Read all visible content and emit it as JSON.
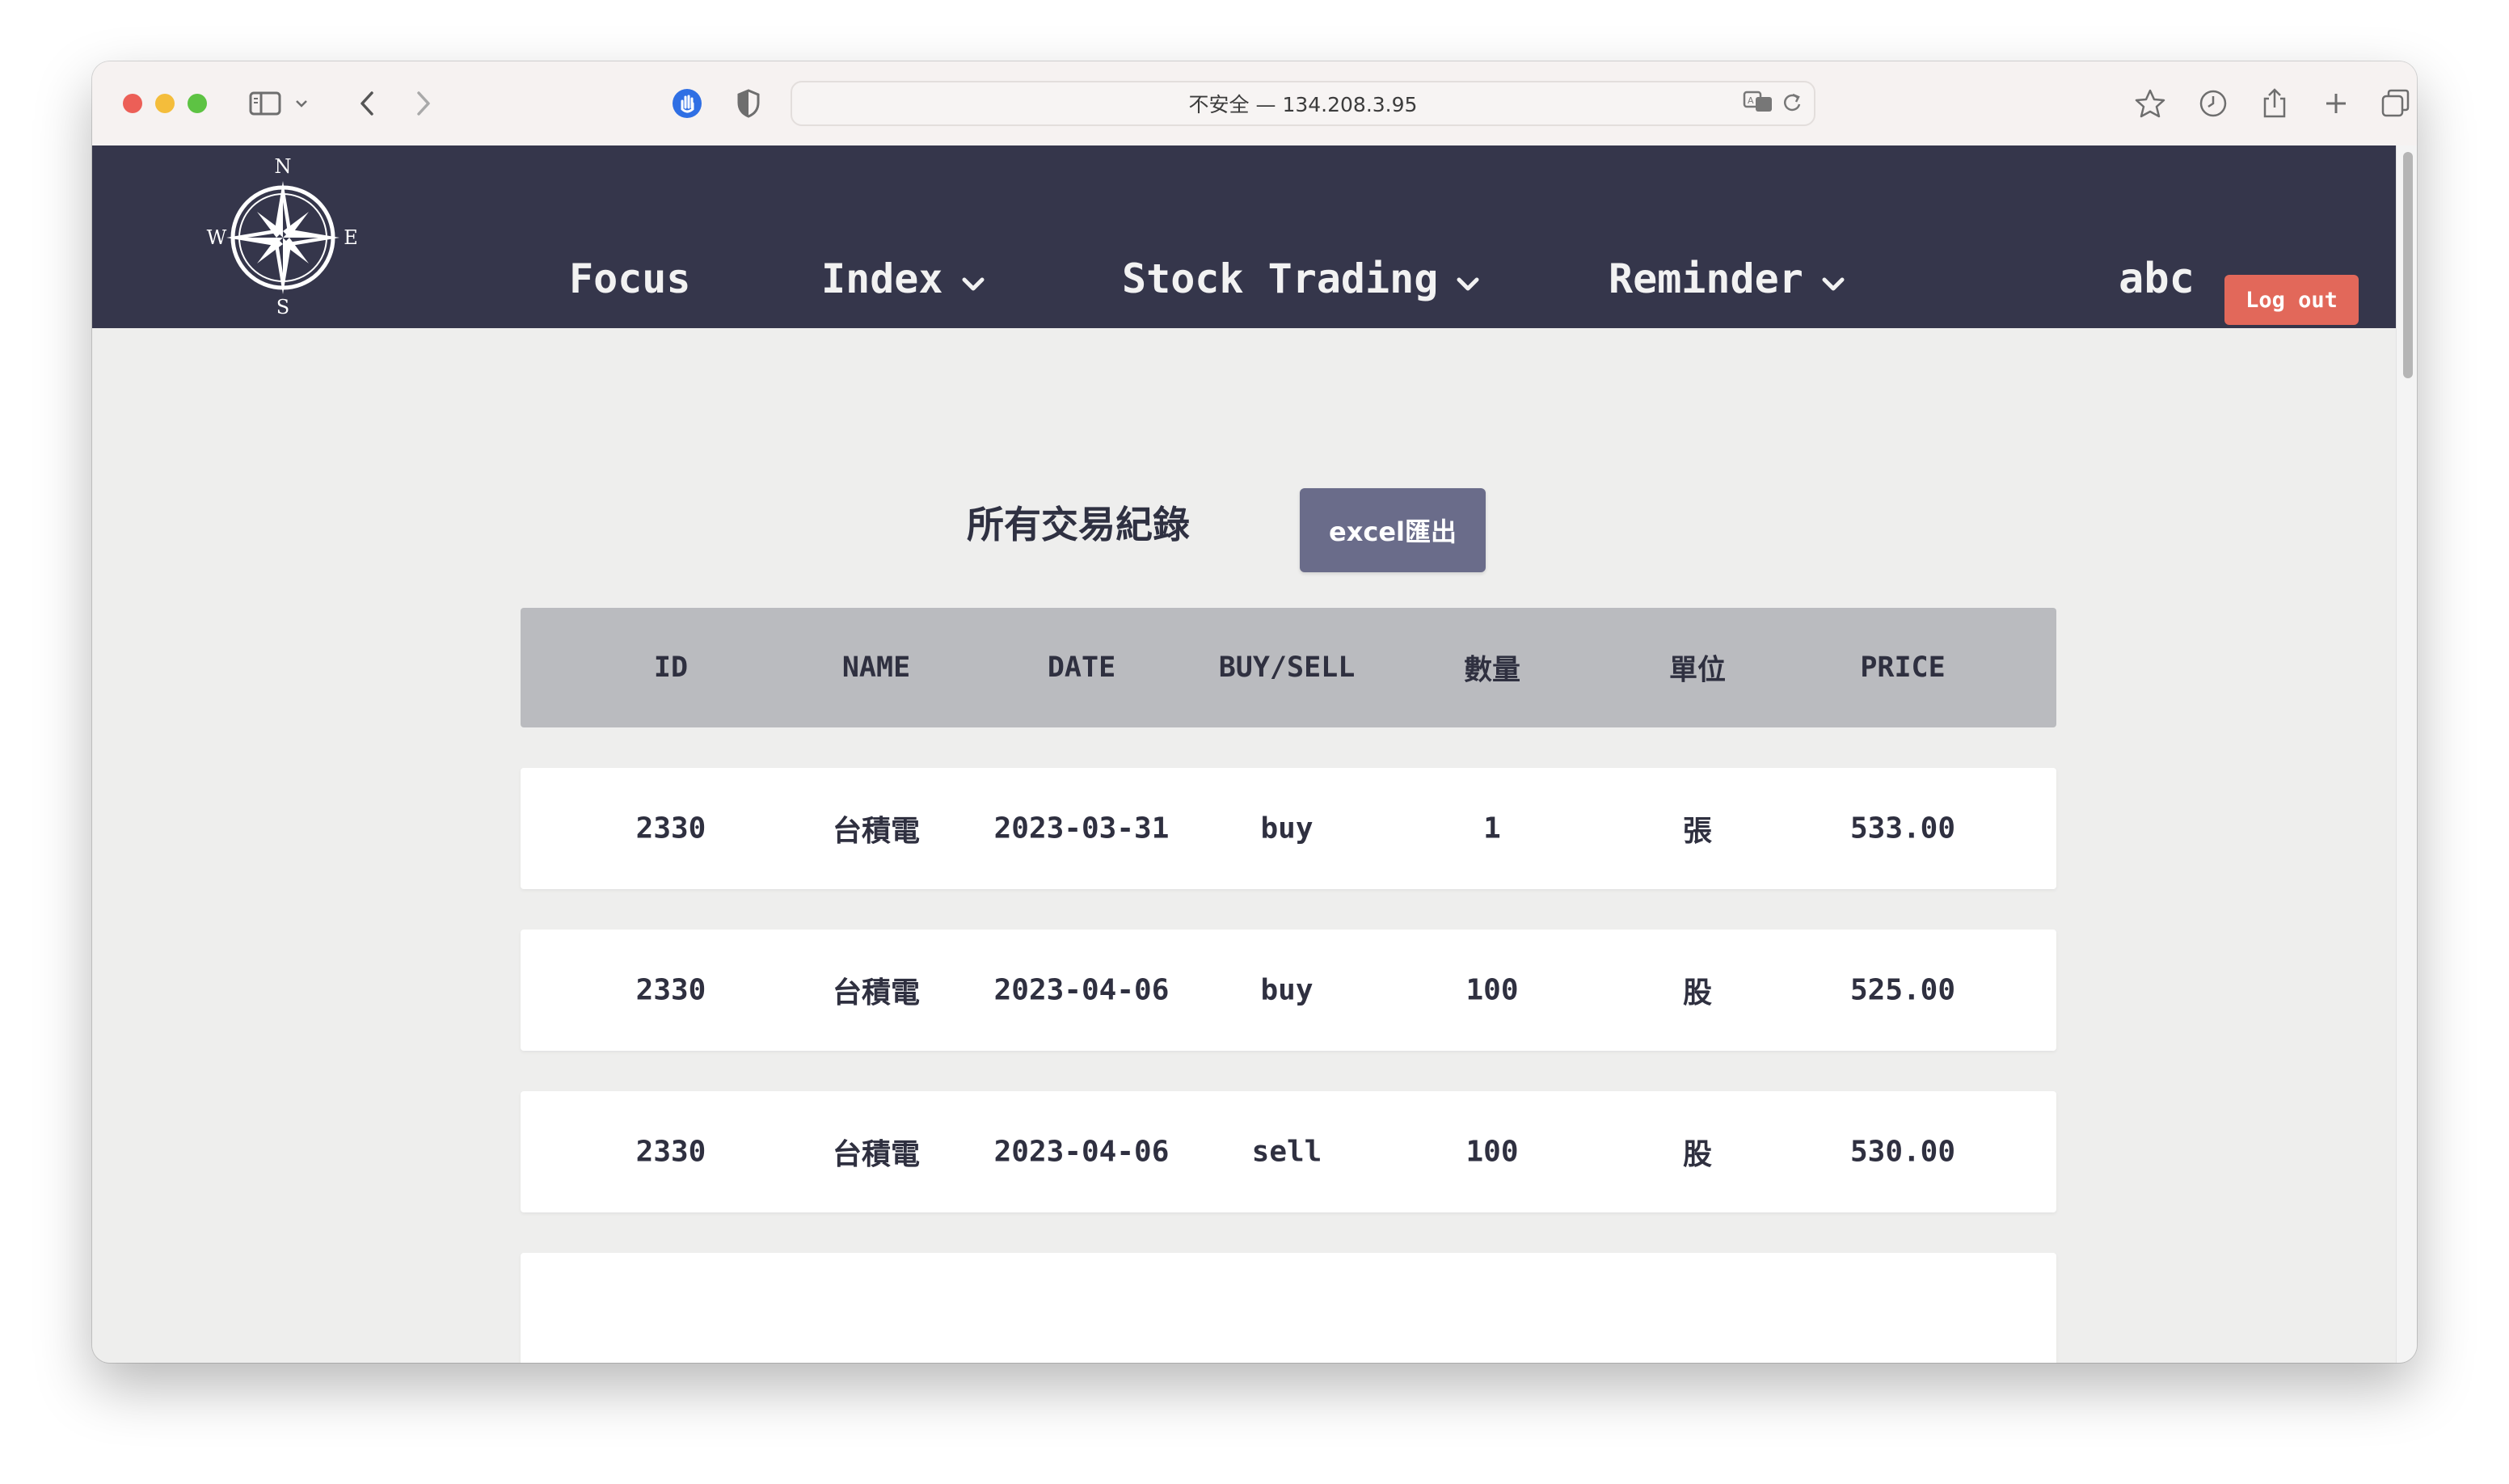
{
  "browser": {
    "url": "不安全 — 134.208.3.95"
  },
  "nav": {
    "logo_letters": {
      "n": "N",
      "e": "E",
      "s": "S",
      "w": "W"
    },
    "items": [
      {
        "label": "Focus",
        "has_dropdown": false
      },
      {
        "label": "Index",
        "has_dropdown": true
      },
      {
        "label": "Stock Trading",
        "has_dropdown": true
      },
      {
        "label": "Reminder",
        "has_dropdown": true
      }
    ],
    "username": "abc",
    "logout_label": "Log out"
  },
  "main": {
    "title": "所有交易紀錄",
    "export_label": "excel匯出"
  },
  "table": {
    "headers": [
      "ID",
      "NAME",
      "DATE",
      "BUY/SELL",
      "數量",
      "單位",
      "PRICE"
    ],
    "rows": [
      [
        "2330",
        "台積電",
        "2023-03-31",
        "buy",
        "1",
        "張",
        "533.00"
      ],
      [
        "2330",
        "台積電",
        "2023-04-06",
        "buy",
        "100",
        "股",
        "525.00"
      ],
      [
        "2330",
        "台積電",
        "2023-04-06",
        "sell",
        "100",
        "股",
        "530.00"
      ]
    ]
  },
  "colors": {
    "nav_bg": "#35364b",
    "logout_bg": "#e2685a",
    "export_bg": "#6a6c8a",
    "table_header_bg": "#babbbf",
    "content_bg": "#eeeeed"
  }
}
